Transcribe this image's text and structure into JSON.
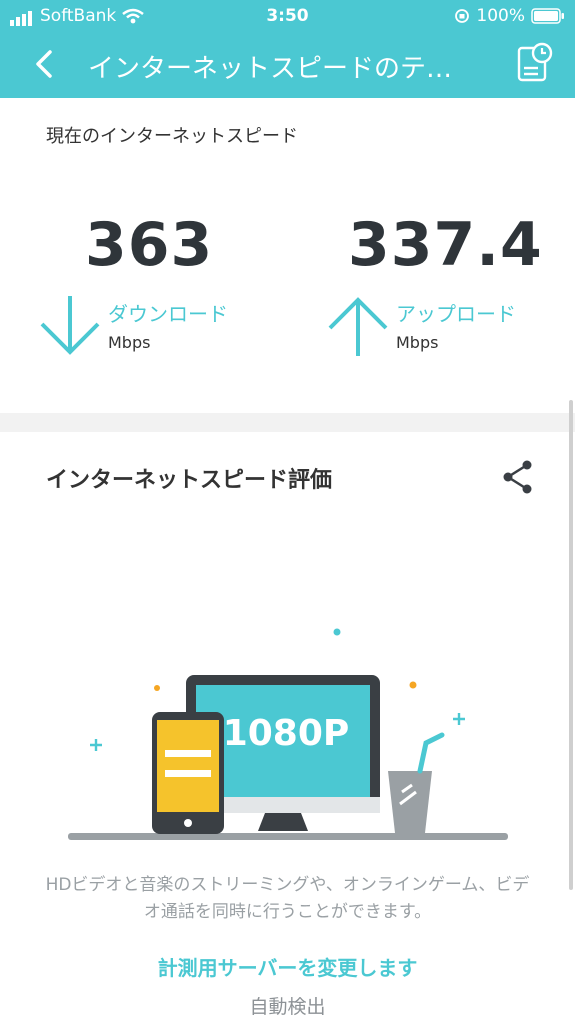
{
  "status": {
    "carrier": "SoftBank",
    "time": "3:50",
    "battery": "100%"
  },
  "nav": {
    "title": "インターネットスピードのテ…"
  },
  "current": {
    "label": "現在のインターネットスピード",
    "download": {
      "value": "363",
      "label": "ダウンロード",
      "unit": "Mbps"
    },
    "upload": {
      "value": "337.4",
      "label": "アップロード",
      "unit": "Mbps"
    }
  },
  "evaluation": {
    "title": "インターネットスピード評価",
    "illustration_text": "1080P",
    "description": "HDビデオと音楽のストリーミングや、オンラインゲーム、ビデオ通話を同時に行うことができます。",
    "change_server": "計測用サーバーを変更します",
    "server_mode": "自動検出"
  },
  "colors": {
    "accent": "#4bc8d2",
    "dark": "#2f353a",
    "yellow": "#f5c32c"
  },
  "icons": [
    "signal-icon",
    "wifi-icon",
    "rotation-lock-icon",
    "battery-icon",
    "back-chevron-icon",
    "history-icon",
    "download-arrow-icon",
    "upload-arrow-icon",
    "share-icon"
  ]
}
